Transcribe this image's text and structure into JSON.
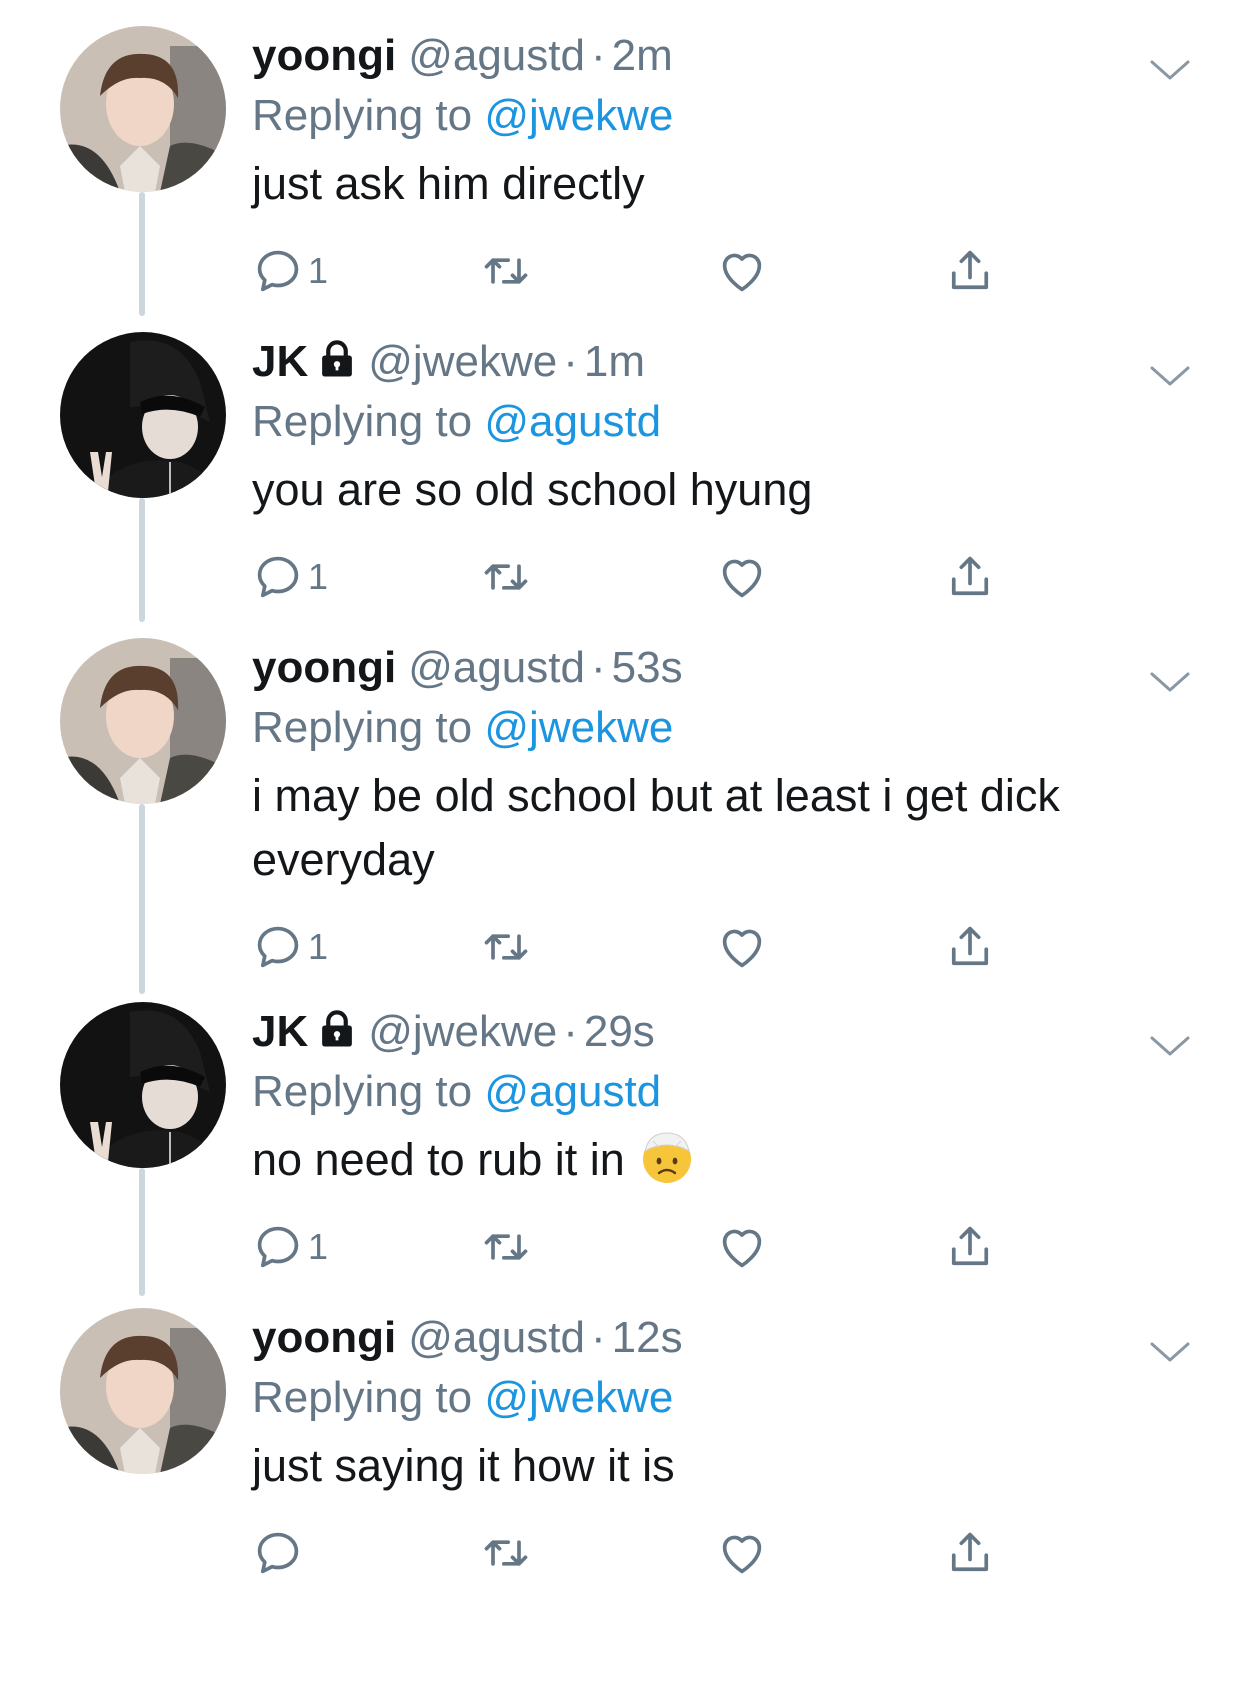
{
  "colors": {
    "text": "#14171a",
    "secondary": "#657786",
    "link": "#1b95e0",
    "thread_line": "#ccd6dd"
  },
  "tweets": [
    {
      "name": "yoongi",
      "handle": "@agustd",
      "separator": "·",
      "time": "2m",
      "replying_prefix": "Replying to",
      "replying_to": "@jwekwe",
      "text": "just ask him directly",
      "reply_count": "1",
      "locked": false,
      "avatar": "yoongi-avatar"
    },
    {
      "name": "JK",
      "handle": "@jwekwe",
      "separator": "·",
      "time": "1m",
      "replying_prefix": "Replying to",
      "replying_to": "@agustd",
      "text": "you are so old school hyung",
      "reply_count": "1",
      "locked": true,
      "avatar": "jk-avatar"
    },
    {
      "name": "yoongi",
      "handle": "@agustd",
      "separator": "·",
      "time": "53s",
      "replying_prefix": "Replying to",
      "replying_to": "@jwekwe",
      "text": "i may be old school but at least i get dick everyday",
      "reply_count": "1",
      "locked": false,
      "avatar": "yoongi-avatar"
    },
    {
      "name": "JK",
      "handle": "@jwekwe",
      "separator": "·",
      "time": "29s",
      "replying_prefix": "Replying to",
      "replying_to": "@agustd",
      "text": "no need to rub it in",
      "emoji": "face-with-head-bandage-emoji",
      "reply_count": "1",
      "locked": true,
      "avatar": "jk-avatar"
    },
    {
      "name": "yoongi",
      "handle": "@agustd",
      "separator": "·",
      "time": "12s",
      "replying_prefix": "Replying to",
      "replying_to": "@jwekwe",
      "text": "just saying it how it is",
      "reply_count": "",
      "locked": false,
      "avatar": "yoongi-avatar"
    }
  ],
  "icons": {
    "reply": "reply-icon",
    "retweet": "retweet-icon",
    "like": "heart-icon",
    "share": "share-icon",
    "menu": "chevron-down-icon",
    "protected": "lock-icon"
  }
}
